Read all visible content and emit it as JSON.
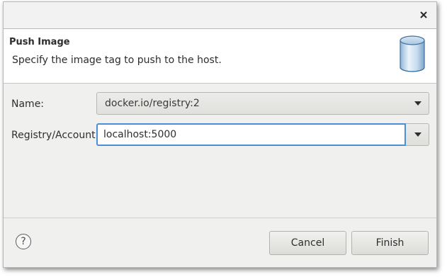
{
  "dialog": {
    "close_icon": "close-icon",
    "header": {
      "title": "Push Image",
      "description": "Specify the image tag to push to the host.",
      "icon": "database-cylinder-icon"
    },
    "fields": {
      "name": {
        "label": "Name:",
        "value": "docker.io/registry:2"
      },
      "registry": {
        "label": "Registry/Account:",
        "value": "localhost:5000"
      }
    },
    "footer": {
      "help_label": "?",
      "cancel_label": "Cancel",
      "finish_label": "Finish"
    }
  },
  "colors": {
    "focus_border": "#4a90d9",
    "dialog_background": "#f0f0ef",
    "header_background": "#ffffff"
  }
}
